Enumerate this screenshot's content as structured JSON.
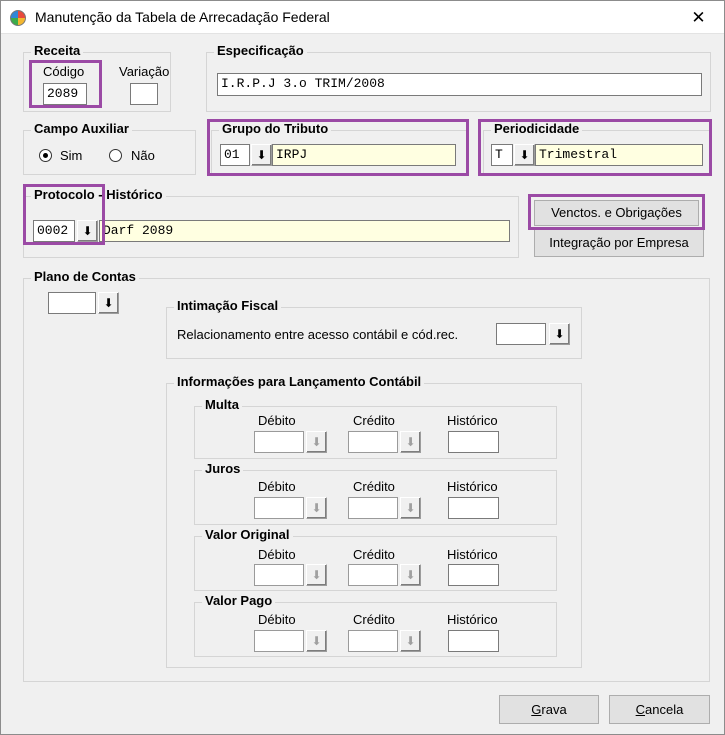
{
  "window": {
    "title": "Manutenção da Tabela de Arrecadação Federal",
    "close_glyph": "✕"
  },
  "receita": {
    "legend": "Receita",
    "codigo_label": "Código",
    "codigo_value": "2089",
    "variacao_label": "Variação",
    "variacao_value": ""
  },
  "especificacao": {
    "legend": "Especificação",
    "value": "I.R.P.J 3.o TRIM/2008"
  },
  "campo_auxiliar": {
    "legend": "Campo Auxiliar",
    "options": [
      {
        "label": "Sim",
        "checked": true
      },
      {
        "label": "Não",
        "checked": false
      }
    ]
  },
  "grupo_tributo": {
    "legend": "Grupo do Tributo",
    "code": "01",
    "description": "IRPJ"
  },
  "periodicidade": {
    "legend": "Periodicidade",
    "code": "T",
    "description": "Trimestral"
  },
  "protocolo": {
    "legend": "Protocolo - Histórico",
    "code": "0002",
    "description": "Darf 2089"
  },
  "buttons": {
    "venctos": "Venctos. e Obrigações",
    "integracao": "Integração por Empresa",
    "grava_first": "G",
    "grava_rest": "rava",
    "cancela_first": "C",
    "cancela_rest": "ancela"
  },
  "plano_contas": {
    "legend": "Plano de Contas",
    "value": ""
  },
  "intimacao": {
    "legend": "Intimação Fiscal",
    "label": "Relacionamento entre acesso contábil e cód.rec.",
    "value": ""
  },
  "lancamento": {
    "legend": "Informações para Lançamento Contábil",
    "col_debito": "Débito",
    "col_credito": "Crédito",
    "col_historico": "Histórico",
    "groups": [
      {
        "legend": "Multa",
        "debito": "",
        "credito": "",
        "historico": ""
      },
      {
        "legend": "Juros",
        "debito": "",
        "credito": "",
        "historico": ""
      },
      {
        "legend": "Valor Original",
        "debito": "",
        "credito": "",
        "historico": ""
      },
      {
        "legend": "Valor Pago",
        "debito": "",
        "credito": "",
        "historico": ""
      }
    ]
  },
  "icons": {
    "dropdown": "⬇"
  },
  "colors": {
    "highlight": "#9b4aa5",
    "lookup_field_bg": "#ffffe1",
    "button_bg": "#e1e1e1",
    "window_bg": "#f0f0f0"
  }
}
